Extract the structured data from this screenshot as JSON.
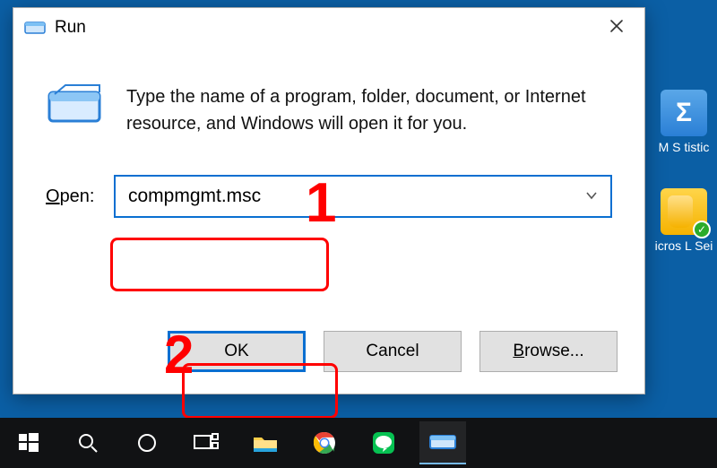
{
  "dialog": {
    "title": "Run",
    "prompt": "Type the name of a program, folder, document, or Internet resource, and Windows will open it for you.",
    "open_label_pre": "O",
    "open_label_rest": "pen:",
    "input_value": "compmgmt.msc",
    "buttons": {
      "ok": "OK",
      "cancel": "Cancel",
      "browse_pre": "B",
      "browse_rest": "rowse..."
    }
  },
  "annotations": {
    "n1": "1",
    "n2": "2"
  },
  "desktop": {
    "item1_label": "M S\ntistic",
    "item2_label": "icros\nL Sei"
  }
}
